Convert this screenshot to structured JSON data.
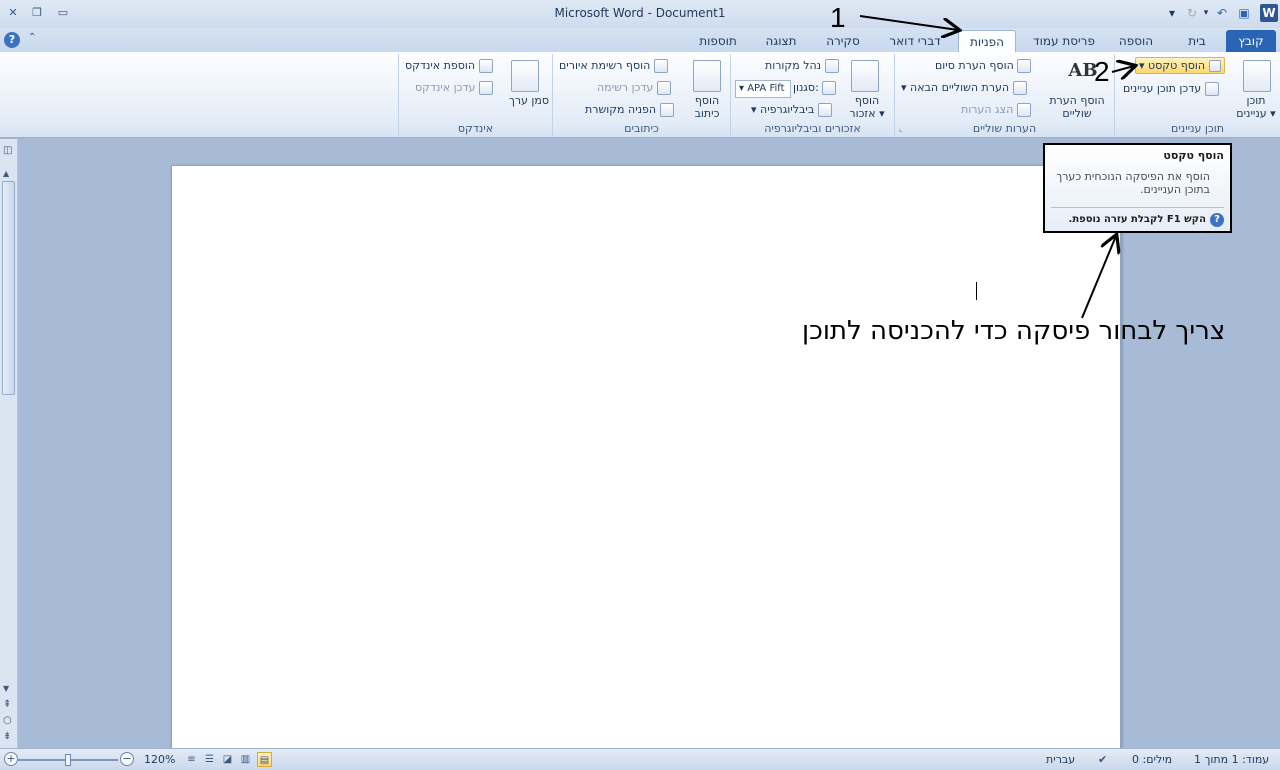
{
  "window": {
    "title": "Microsoft Word  -  Document1",
    "app_icon": "W"
  },
  "tabs": [
    {
      "label": "קובץ",
      "id": "file"
    },
    {
      "label": "בית",
      "id": "home"
    },
    {
      "label": "הוספה",
      "id": "insert"
    },
    {
      "label": "פריסת עמוד",
      "id": "layout"
    },
    {
      "label": "הפניות",
      "id": "references"
    },
    {
      "label": "דברי דואר",
      "id": "mailings"
    },
    {
      "label": "סקירה",
      "id": "review"
    },
    {
      "label": "תצוגה",
      "id": "view"
    },
    {
      "label": "תוספות",
      "id": "addins"
    }
  ],
  "ribbon": {
    "toc": {
      "label": "תוכן עניינים",
      "toc_button": "תוכן עניינים",
      "add_text": "הוסף טקסט",
      "update_toc": "עדכן תוכן עניינים"
    },
    "footnotes": {
      "label": "הערות שוליים",
      "insert_footnote": "הוסף הערת שוליים",
      "insert_endnote": "הוסף הערת סיום",
      "next_footnote": "הערת השוליים הבאה",
      "show_notes": "הצג הערות",
      "ab_glyph": "AB"
    },
    "citations": {
      "label": "אזכורים וביבליוגרפיה",
      "insert_citation": "הוסף אזכור",
      "manage_sources": "נהל מקורות",
      "style_label": "סגנון:",
      "style_value": "APA Fift",
      "bibliography": "ביבליוגרפיה"
    },
    "captions": {
      "label": "כיתובים",
      "insert_caption": "הוסף כיתוב",
      "insert_table_figures": "הוסף רשימת איורים",
      "update_table": "עדכן רשימה",
      "cross_reference": "הפניה מקושרת"
    },
    "index": {
      "label": "אינדקס",
      "mark_entry": "סמן ערך",
      "insert_index": "הוספת אינדקס",
      "update_index": "עדכן אינדקס"
    }
  },
  "tooltip": {
    "title": "הוסף טקסט",
    "body": "הוסף את הפיסקה הנוכחית כערך בתוכן העניינים.",
    "help": "הקש F1 לקבלת עזרה נוספת."
  },
  "annotations": {
    "step1": "1",
    "step2": "2",
    "note": "צריך לבחור פיסקה כדי להכניסה לתוכן"
  },
  "status": {
    "page": "עמוד: 1 מתוך 1",
    "words": "מילים: 0",
    "language": "עברית",
    "zoom": "120%",
    "zoom_fraction": 0.5
  }
}
